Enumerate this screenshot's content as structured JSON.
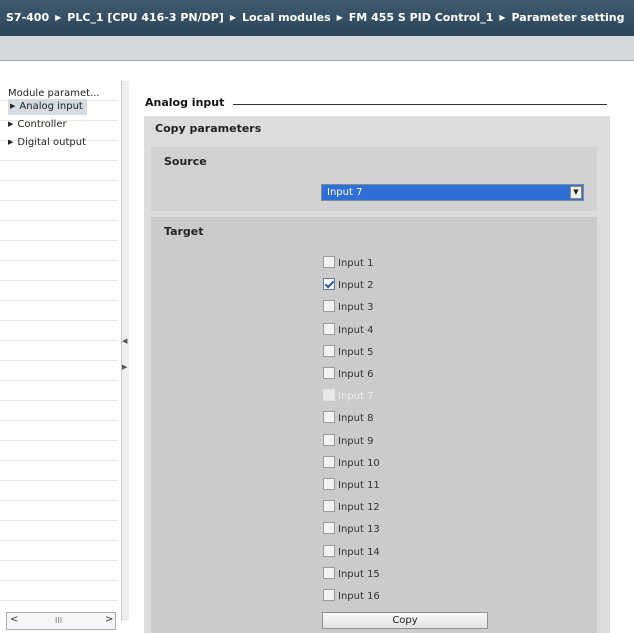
{
  "breadcrumb": {
    "items": [
      "S7-400",
      "PLC_1 [CPU 416-3 PN/DP]",
      "Local modules",
      "FM 455 S PID Control_1",
      "Parameter setting"
    ]
  },
  "nav": {
    "items": [
      {
        "label": "Module paramet...",
        "has_arrow": false,
        "selected": false
      },
      {
        "label": "Analog input",
        "has_arrow": true,
        "selected": true
      },
      {
        "label": "Controller",
        "has_arrow": true,
        "selected": false
      },
      {
        "label": "Digital output",
        "has_arrow": true,
        "selected": false
      }
    ],
    "scroll_left": "<",
    "scroll_thumb": "III",
    "scroll_right": ">"
  },
  "section": {
    "title": "Analog input",
    "copy_title": "Copy parameters",
    "source_title": "Source",
    "source_value": "Input  7",
    "target_title": "Target",
    "copy_button": "Copy"
  },
  "targets": [
    {
      "label": "Input  1",
      "checked": false,
      "disabled": false
    },
    {
      "label": "Input  2",
      "checked": true,
      "disabled": false
    },
    {
      "label": "Input  3",
      "checked": false,
      "disabled": false
    },
    {
      "label": "Input  4",
      "checked": false,
      "disabled": false
    },
    {
      "label": "Input  5",
      "checked": false,
      "disabled": false
    },
    {
      "label": "Input  6",
      "checked": false,
      "disabled": false
    },
    {
      "label": "Input  7",
      "checked": false,
      "disabled": true
    },
    {
      "label": "Input  8",
      "checked": false,
      "disabled": false
    },
    {
      "label": "Input  9",
      "checked": false,
      "disabled": false
    },
    {
      "label": "Input  10",
      "checked": false,
      "disabled": false
    },
    {
      "label": "Input  11",
      "checked": false,
      "disabled": false
    },
    {
      "label": "Input  12",
      "checked": false,
      "disabled": false
    },
    {
      "label": "Input  13",
      "checked": false,
      "disabled": false
    },
    {
      "label": "Input  14",
      "checked": false,
      "disabled": false
    },
    {
      "label": "Input  15",
      "checked": false,
      "disabled": false
    },
    {
      "label": "Input  16",
      "checked": false,
      "disabled": false
    }
  ],
  "colors": {
    "title_bar": "#35505f",
    "dropdown_selected": "#2e6fd6",
    "checkbox_check": "#2a5fa0"
  }
}
